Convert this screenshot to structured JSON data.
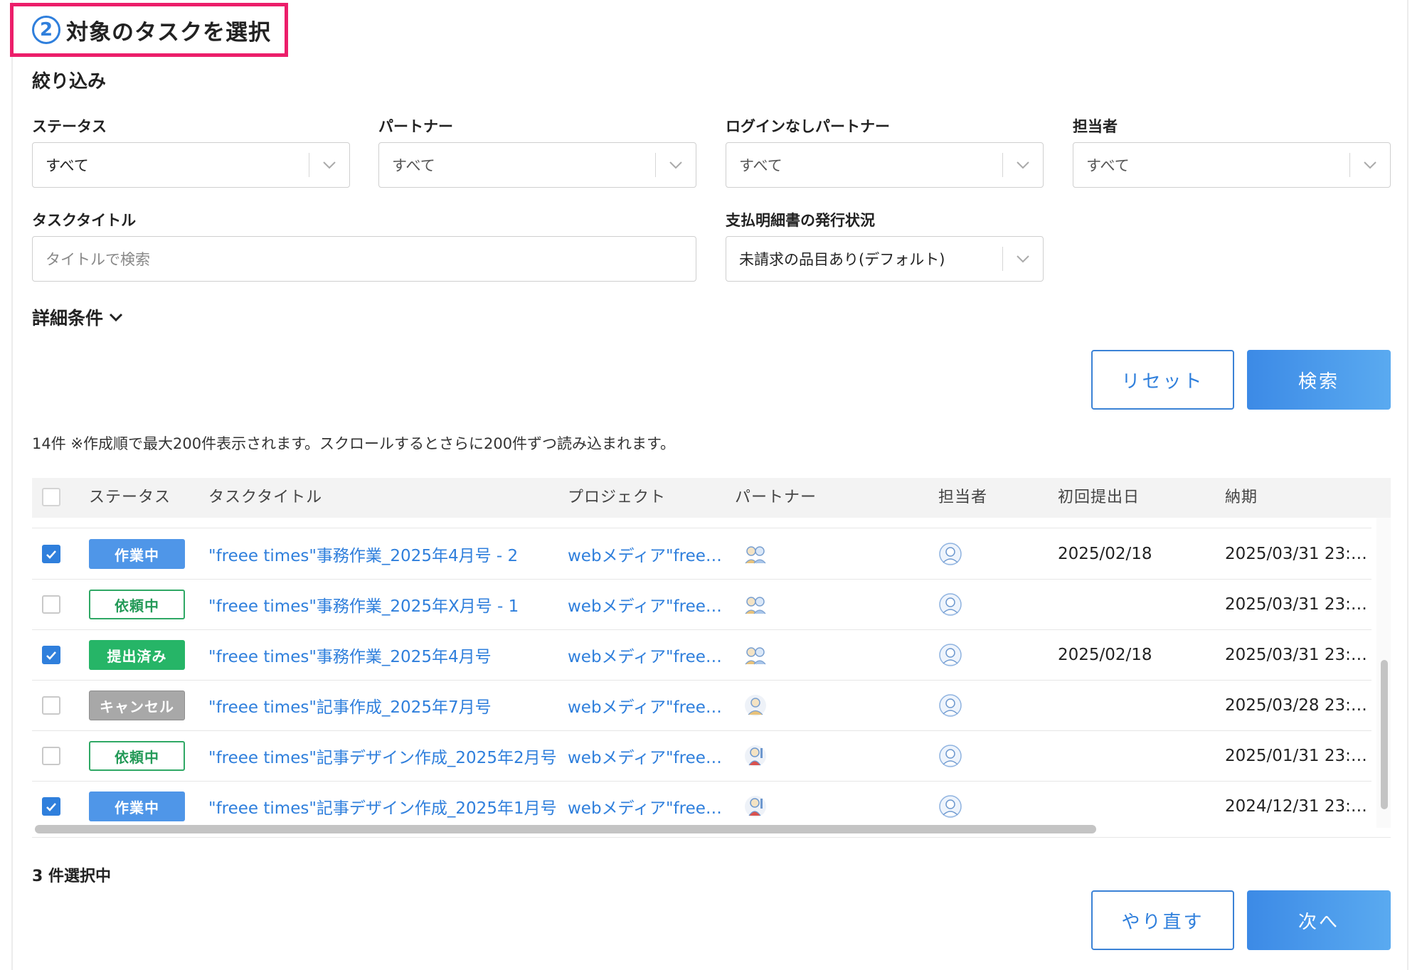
{
  "heading": {
    "step": "2",
    "title": "対象のタスクを選択"
  },
  "filter": {
    "title": "絞り込み",
    "status": {
      "label": "ステータス",
      "value": "すべて"
    },
    "partner": {
      "label": "パートナー",
      "value": "すべて"
    },
    "nologin_partner": {
      "label": "ログインなしパートナー",
      "value": "すべて"
    },
    "assignee": {
      "label": "担当者",
      "value": "すべて"
    },
    "task_title": {
      "label": "タスクタイトル",
      "placeholder": "タイトルで検索"
    },
    "statement": {
      "label": "支払明細書の発行状況",
      "value": "未請求の品目あり(デフォルト)"
    },
    "detail": "詳細条件",
    "reset": "リセット",
    "search": "検索"
  },
  "result_note": "14件 ※作成順で最大200件表示されます。スクロールするとさらに200件ずつ読み込まれます。",
  "table": {
    "columns": [
      "ステータス",
      "タスクタイトル",
      "プロジェクト",
      "パートナー",
      "担当者",
      "初回提出日",
      "納期"
    ],
    "rows": [
      {
        "checked": true,
        "status": "作業中",
        "status_style": "blue",
        "title": "\"freee times\"事務作業_2025年4月号 - 2",
        "project": "webメディア\"free…",
        "partner_icon": "partner-avatar-group-icon",
        "first_submit": "2025/02/18",
        "due": "2025/03/31 23:…"
      },
      {
        "checked": false,
        "status": "依頼中",
        "status_style": "green-outline",
        "title": "\"freee times\"事務作業_2025年X月号 - 1",
        "project": "webメディア\"free…",
        "partner_icon": "partner-avatar-group-icon",
        "first_submit": "",
        "due": "2025/03/31 23:…"
      },
      {
        "checked": true,
        "status": "提出済み",
        "status_style": "green",
        "title": "\"freee times\"事務作業_2025年4月号",
        "project": "webメディア\"free…",
        "partner_icon": "partner-avatar-group-icon",
        "first_submit": "2025/02/18",
        "due": "2025/03/31 23:…"
      },
      {
        "checked": false,
        "status": "キャンセル",
        "status_style": "gray",
        "title": "\"freee times\"記事作成_2025年7月号",
        "project": "webメディア\"free…",
        "partner_icon": "partner-avatar-single-icon",
        "first_submit": "",
        "due": "2025/03/28 23:…"
      },
      {
        "checked": false,
        "status": "依頼中",
        "status_style": "green-outline",
        "title": "\"freee times\"記事デザイン作成_2025年2月号",
        "project": "webメディア\"free…",
        "partner_icon": "partner-avatar-designer-icon",
        "first_submit": "",
        "due": "2025/01/31 23:…"
      },
      {
        "checked": true,
        "status": "作業中",
        "status_style": "blue",
        "title": "\"freee times\"記事デザイン作成_2025年1月号",
        "project": "webメディア\"free…",
        "partner_icon": "partner-avatar-designer-icon",
        "first_submit": "",
        "due": "2024/12/31 23:…"
      }
    ]
  },
  "selected_count": "3 件選択中",
  "footer": {
    "redo": "やり直す",
    "next": "次へ"
  },
  "colors": {
    "accent": "#2f7fdc",
    "highlight_border": "#ec1e6a",
    "status_done": "#26b567",
    "status_cancel": "#a8a8a8"
  }
}
